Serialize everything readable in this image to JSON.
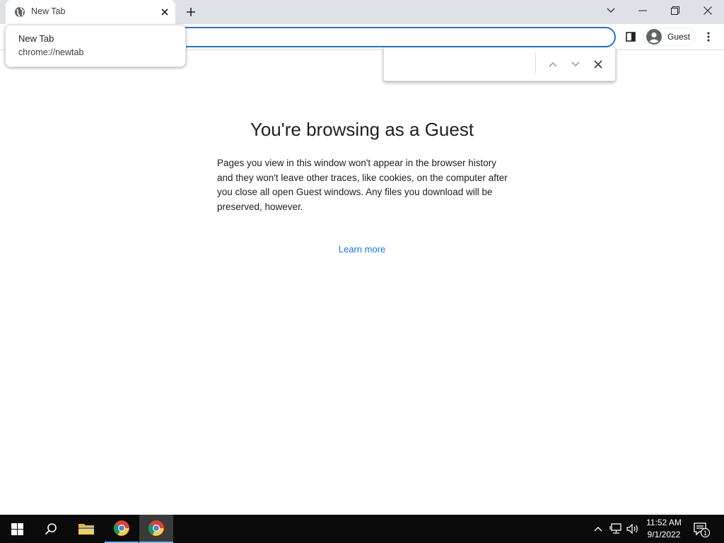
{
  "tabs": [
    {
      "title": "New Tab",
      "favicon": "globe-icon"
    }
  ],
  "hover_card": {
    "title": "New Tab",
    "url": "chrome://newtab"
  },
  "profile": {
    "label": "Guest"
  },
  "find_bar": {
    "query": ""
  },
  "page": {
    "heading": "You're browsing as a Guest",
    "description": "Pages you view in this window won't appear in the browser history and they won't leave other traces, like cookies, on the computer after you close all open Guest windows. Any files you download will be preserved, however.",
    "learn_more": "Learn more"
  },
  "taskbar": {
    "time": "11:52 AM",
    "date": "9/1/2022",
    "notification_count": "1"
  },
  "colors": {
    "accent": "#1a73e8",
    "tabstrip": "#dee1e6",
    "taskbar": "#0b0b0b"
  }
}
